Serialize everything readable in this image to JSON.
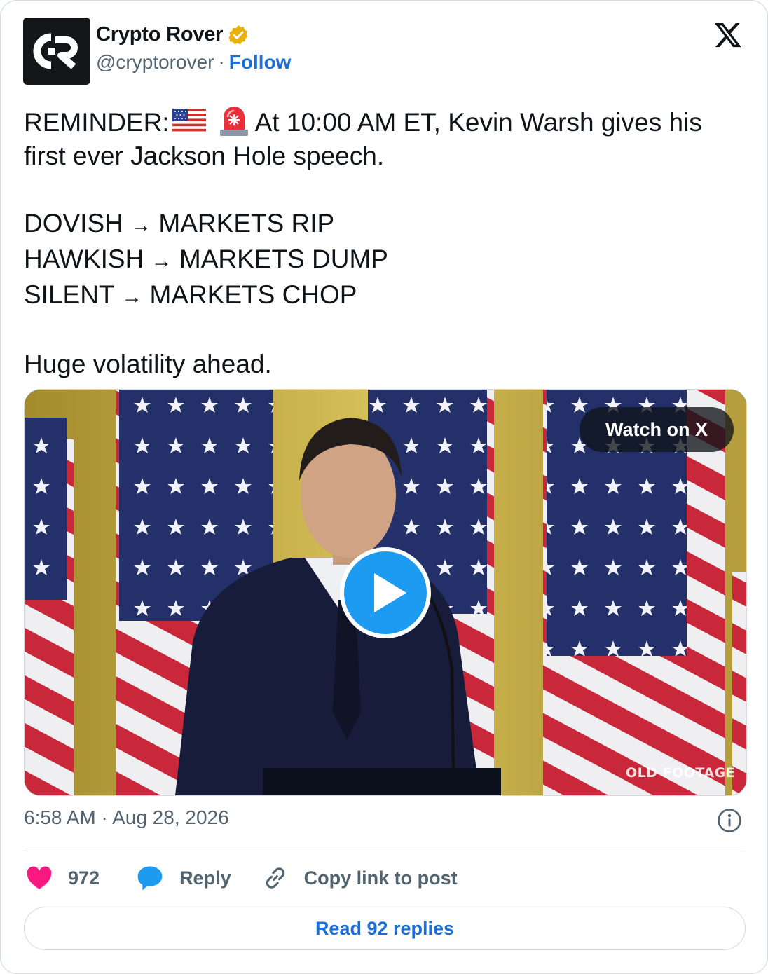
{
  "author": {
    "name": "Crypto Rover",
    "handle": "@cryptorover",
    "separator": "·",
    "follow_label": "Follow",
    "avatar_icon": "cr-logo-icon",
    "verified_icon": "gold-verified-badge-icon"
  },
  "platform_icon": "x-logo-icon",
  "post": {
    "line1_prefix": "REMINDER:",
    "line1_emojis": [
      "us-flag-emoji",
      "rotating-light-emoji"
    ],
    "line1_rest": "At 10:00 AM ET, Kevin Warsh gives his first ever Jackson Hole speech.",
    "scenarios": [
      {
        "condition": "DOVISH",
        "arrow": "→",
        "outcome": "MARKETS RIP"
      },
      {
        "condition": "HAWKISH",
        "arrow": "→",
        "outcome": "MARKETS DUMP"
      },
      {
        "condition": "SILENT",
        "arrow": "→",
        "outcome": "MARKETS CHOP"
      }
    ],
    "closing": "Huge volatility ahead."
  },
  "media": {
    "watch_label": "Watch on X",
    "overlay_text": "OLD FOOTAGE",
    "play_icon": "play-icon"
  },
  "timestamp": "6:58 AM · Aug 28, 2026",
  "actions": {
    "like_count": "972",
    "reply_label": "Reply",
    "copy_label": "Copy link to post"
  },
  "read_replies_label": "Read 92 replies",
  "colors": {
    "link_blue": "#1d6fd6",
    "like_pink": "#f91880",
    "reply_blue": "#1d9bf0",
    "muted_gray": "#536471",
    "border": "#cfd9de"
  }
}
